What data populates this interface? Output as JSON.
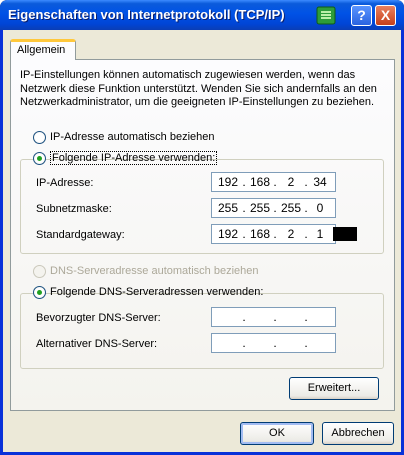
{
  "window": {
    "title": "Eigenschaften von Internetprotokoll (TCP/IP)",
    "help_label": "?",
    "close_label": "X"
  },
  "tabs": [
    {
      "label": "Allgemein",
      "active": true
    }
  ],
  "intro_text": "IP-Einstellungen können automatisch zugewiesen werden, wenn das Netzwerk diese Funktion unterstützt. Wenden Sie sich andernfalls an den Netzwerkadministrator, um die geeigneten IP-Einstellungen zu beziehen.",
  "ip_section": {
    "auto_label": "IP-Adresse automatisch beziehen",
    "auto_selected": false,
    "manual_label": "Folgende IP-Adresse verwenden:",
    "manual_selected": true,
    "fields": [
      {
        "label": "IP-Adresse:",
        "octets": [
          "192",
          "168",
          "2",
          "34"
        ]
      },
      {
        "label": "Subnetzmaske:",
        "octets": [
          "255",
          "255",
          "255",
          "0"
        ]
      },
      {
        "label": "Standardgateway:",
        "octets": [
          "192",
          "168",
          "2",
          "1"
        ]
      }
    ]
  },
  "dns_section": {
    "auto_label": "DNS-Serveradresse automatisch beziehen",
    "auto_enabled": false,
    "manual_label": "Folgende DNS-Serveradressen verwenden:",
    "manual_selected": true,
    "fields": [
      {
        "label": "Bevorzugter DNS-Server:",
        "octets": [
          "",
          "",
          "",
          ""
        ]
      },
      {
        "label": "Alternativer DNS-Server:",
        "octets": [
          "",
          "",
          "",
          ""
        ]
      }
    ]
  },
  "ip_dot": ".",
  "buttons": {
    "advanced": "Erweitert...",
    "ok": "OK",
    "cancel": "Abbrechen"
  },
  "colors": {
    "titlebar": "#0052e6",
    "dialog_bg": "#ece9d8",
    "radio_check": "#21a121",
    "tab_highlight": "#ffc83c"
  }
}
